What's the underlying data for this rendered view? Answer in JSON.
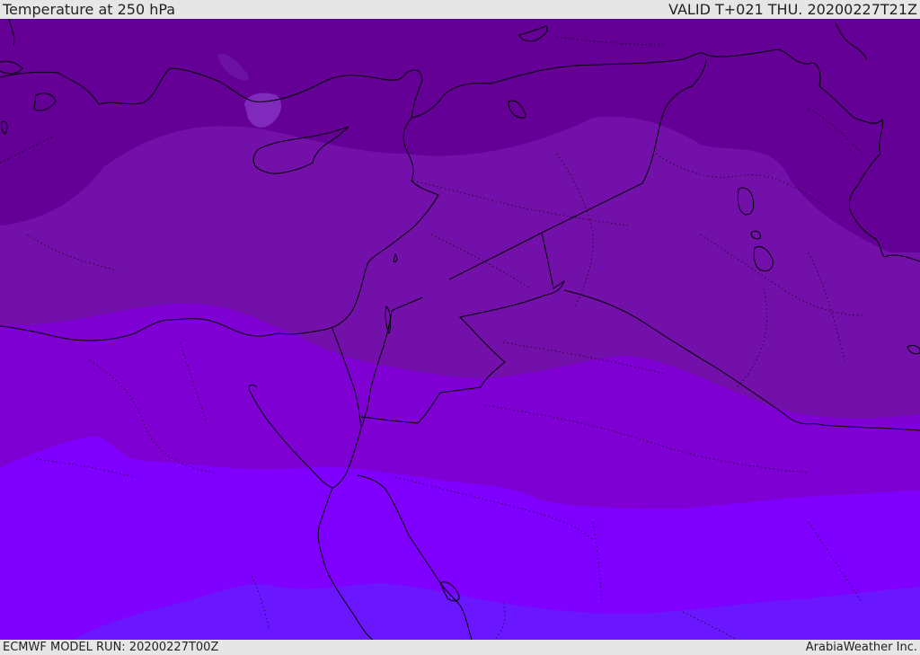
{
  "header": {
    "title": "Temperature at 250 hPa",
    "valid": "VALID T+021 THU. 20200227T21Z"
  },
  "footer": {
    "model_run": "ECMWF MODEL RUN: 20200227T00Z",
    "credit": "ArabiaWeather Inc."
  },
  "map": {
    "variable": "temperature",
    "level": "250 hPa",
    "shading_colors": {
      "band_1": "#640096",
      "band_2": "#7310aa",
      "band_3": "#7e00d2",
      "band_4": "#7f00ff",
      "band_5": "#6a16ff",
      "highlight": "#8530c4"
    },
    "line_color": "#000000"
  }
}
